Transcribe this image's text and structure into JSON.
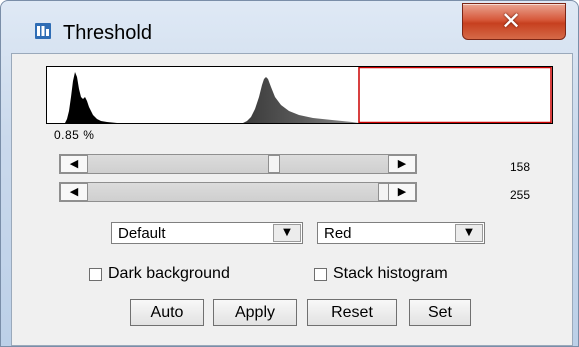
{
  "window": {
    "title": "Threshold",
    "close_icon": "close-icon"
  },
  "histogram": {
    "percent_label": "0.85 %",
    "threshold_color": "#cc0000"
  },
  "sliders": {
    "lower": {
      "value": "158",
      "value_num": 158,
      "max": 255
    },
    "upper": {
      "value": "255",
      "value_num": 255,
      "max": 255
    }
  },
  "dropdowns": {
    "method": {
      "selected": "Default"
    },
    "display": {
      "selected": "Red"
    }
  },
  "checkboxes": {
    "dark_background": {
      "label": "Dark background",
      "checked": false
    },
    "stack_histogram": {
      "label": "Stack histogram",
      "checked": false
    }
  },
  "buttons": {
    "auto": "Auto",
    "apply": "Apply",
    "reset": "Reset",
    "set": "Set"
  }
}
